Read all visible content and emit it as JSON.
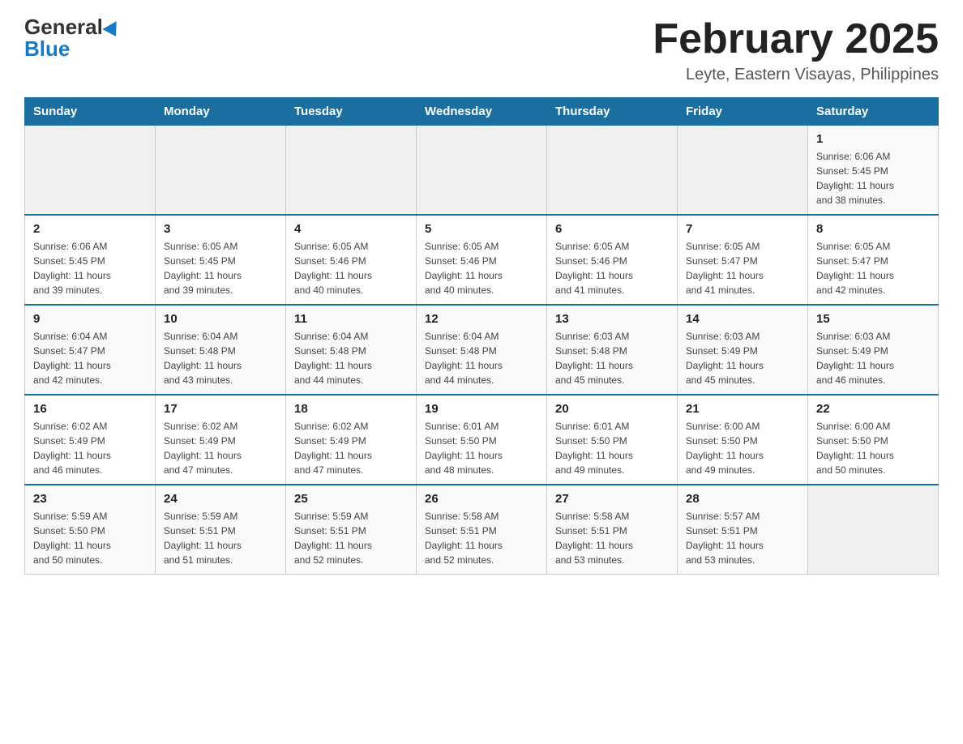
{
  "header": {
    "logo_general": "General",
    "logo_blue": "Blue",
    "month_title": "February 2025",
    "location": "Leyte, Eastern Visayas, Philippines"
  },
  "weekdays": [
    "Sunday",
    "Monday",
    "Tuesday",
    "Wednesday",
    "Thursday",
    "Friday",
    "Saturday"
  ],
  "weeks": [
    [
      {
        "day": "",
        "info": ""
      },
      {
        "day": "",
        "info": ""
      },
      {
        "day": "",
        "info": ""
      },
      {
        "day": "",
        "info": ""
      },
      {
        "day": "",
        "info": ""
      },
      {
        "day": "",
        "info": ""
      },
      {
        "day": "1",
        "info": "Sunrise: 6:06 AM\nSunset: 5:45 PM\nDaylight: 11 hours\nand 38 minutes."
      }
    ],
    [
      {
        "day": "2",
        "info": "Sunrise: 6:06 AM\nSunset: 5:45 PM\nDaylight: 11 hours\nand 39 minutes."
      },
      {
        "day": "3",
        "info": "Sunrise: 6:05 AM\nSunset: 5:45 PM\nDaylight: 11 hours\nand 39 minutes."
      },
      {
        "day": "4",
        "info": "Sunrise: 6:05 AM\nSunset: 5:46 PM\nDaylight: 11 hours\nand 40 minutes."
      },
      {
        "day": "5",
        "info": "Sunrise: 6:05 AM\nSunset: 5:46 PM\nDaylight: 11 hours\nand 40 minutes."
      },
      {
        "day": "6",
        "info": "Sunrise: 6:05 AM\nSunset: 5:46 PM\nDaylight: 11 hours\nand 41 minutes."
      },
      {
        "day": "7",
        "info": "Sunrise: 6:05 AM\nSunset: 5:47 PM\nDaylight: 11 hours\nand 41 minutes."
      },
      {
        "day": "8",
        "info": "Sunrise: 6:05 AM\nSunset: 5:47 PM\nDaylight: 11 hours\nand 42 minutes."
      }
    ],
    [
      {
        "day": "9",
        "info": "Sunrise: 6:04 AM\nSunset: 5:47 PM\nDaylight: 11 hours\nand 42 minutes."
      },
      {
        "day": "10",
        "info": "Sunrise: 6:04 AM\nSunset: 5:48 PM\nDaylight: 11 hours\nand 43 minutes."
      },
      {
        "day": "11",
        "info": "Sunrise: 6:04 AM\nSunset: 5:48 PM\nDaylight: 11 hours\nand 44 minutes."
      },
      {
        "day": "12",
        "info": "Sunrise: 6:04 AM\nSunset: 5:48 PM\nDaylight: 11 hours\nand 44 minutes."
      },
      {
        "day": "13",
        "info": "Sunrise: 6:03 AM\nSunset: 5:48 PM\nDaylight: 11 hours\nand 45 minutes."
      },
      {
        "day": "14",
        "info": "Sunrise: 6:03 AM\nSunset: 5:49 PM\nDaylight: 11 hours\nand 45 minutes."
      },
      {
        "day": "15",
        "info": "Sunrise: 6:03 AM\nSunset: 5:49 PM\nDaylight: 11 hours\nand 46 minutes."
      }
    ],
    [
      {
        "day": "16",
        "info": "Sunrise: 6:02 AM\nSunset: 5:49 PM\nDaylight: 11 hours\nand 46 minutes."
      },
      {
        "day": "17",
        "info": "Sunrise: 6:02 AM\nSunset: 5:49 PM\nDaylight: 11 hours\nand 47 minutes."
      },
      {
        "day": "18",
        "info": "Sunrise: 6:02 AM\nSunset: 5:49 PM\nDaylight: 11 hours\nand 47 minutes."
      },
      {
        "day": "19",
        "info": "Sunrise: 6:01 AM\nSunset: 5:50 PM\nDaylight: 11 hours\nand 48 minutes."
      },
      {
        "day": "20",
        "info": "Sunrise: 6:01 AM\nSunset: 5:50 PM\nDaylight: 11 hours\nand 49 minutes."
      },
      {
        "day": "21",
        "info": "Sunrise: 6:00 AM\nSunset: 5:50 PM\nDaylight: 11 hours\nand 49 minutes."
      },
      {
        "day": "22",
        "info": "Sunrise: 6:00 AM\nSunset: 5:50 PM\nDaylight: 11 hours\nand 50 minutes."
      }
    ],
    [
      {
        "day": "23",
        "info": "Sunrise: 5:59 AM\nSunset: 5:50 PM\nDaylight: 11 hours\nand 50 minutes."
      },
      {
        "day": "24",
        "info": "Sunrise: 5:59 AM\nSunset: 5:51 PM\nDaylight: 11 hours\nand 51 minutes."
      },
      {
        "day": "25",
        "info": "Sunrise: 5:59 AM\nSunset: 5:51 PM\nDaylight: 11 hours\nand 52 minutes."
      },
      {
        "day": "26",
        "info": "Sunrise: 5:58 AM\nSunset: 5:51 PM\nDaylight: 11 hours\nand 52 minutes."
      },
      {
        "day": "27",
        "info": "Sunrise: 5:58 AM\nSunset: 5:51 PM\nDaylight: 11 hours\nand 53 minutes."
      },
      {
        "day": "28",
        "info": "Sunrise: 5:57 AM\nSunset: 5:51 PM\nDaylight: 11 hours\nand 53 minutes."
      },
      {
        "day": "",
        "info": ""
      }
    ]
  ]
}
